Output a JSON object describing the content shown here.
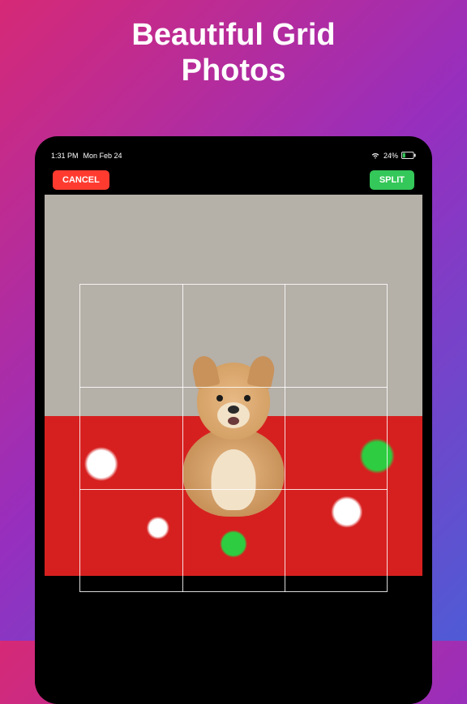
{
  "marketing": {
    "headline_line1": "Beautiful Grid",
    "headline_line2": "Photos"
  },
  "statusBar": {
    "time": "1:31 PM",
    "date": "Mon Feb 24",
    "batteryPercent": "24%"
  },
  "toolbar": {
    "cancel_label": "CANCEL",
    "split_label": "SPLIT"
  },
  "colors": {
    "cancel": "#ff3b30",
    "split": "#34c759",
    "gradient_start": "#d62976",
    "gradient_mid": "#962fbf",
    "gradient_end": "#4f5bd5"
  },
  "grid": {
    "rows": 3,
    "cols": 3
  },
  "photo": {
    "subject": "Pomeranian dog on a red character-print blanket",
    "background_wall": "#b5b0a8",
    "blanket_color": "#d6201f"
  }
}
